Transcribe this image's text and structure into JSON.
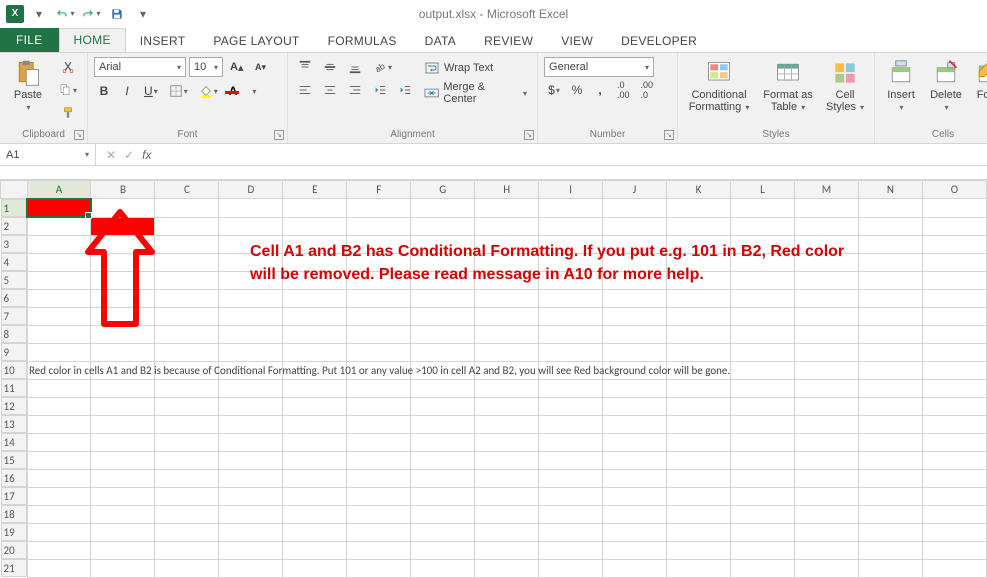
{
  "title": "output.xlsx - Microsoft Excel",
  "qat_xl": "X",
  "tabs": {
    "file": "FILE",
    "home": "HOME",
    "insert": "INSERT",
    "pagelayout": "PAGE LAYOUT",
    "formulas": "FORMULAS",
    "data": "DATA",
    "review": "REVIEW",
    "view": "VIEW",
    "developer": "DEVELOPER"
  },
  "ribbon": {
    "clipboard": {
      "paste": "Paste",
      "label": "Clipboard"
    },
    "font": {
      "name": "Arial",
      "size": "10",
      "label": "Font"
    },
    "alignment": {
      "wrap": "Wrap Text",
      "merge": "Merge & Center",
      "label": "Alignment"
    },
    "number": {
      "fmt": "General",
      "label": "Number"
    },
    "styles": {
      "cond": "Conditional\nFormatting",
      "fmtas": "Format as\nTable",
      "cell": "Cell\nStyles",
      "label": "Styles"
    },
    "cells": {
      "insert": "Insert",
      "delete": "Delete",
      "format": "Forn",
      "label": "Cells"
    }
  },
  "namebox": "A1",
  "columns": [
    "A",
    "B",
    "C",
    "D",
    "E",
    "F",
    "G",
    "H",
    "I",
    "J",
    "K",
    "L",
    "M",
    "N",
    "O"
  ],
  "rows": [
    "1",
    "2",
    "3",
    "4",
    "5",
    "6",
    "7",
    "8",
    "9",
    "10",
    "11",
    "12",
    "13",
    "14",
    "15",
    "16",
    "17",
    "18",
    "19",
    "20",
    "21"
  ],
  "row10_text": "Red color in cells A1 and B2 is because of Conditional Formatting. Put 101 or any value >100 in cell A2 and B2, you will see Red background color will be gone.",
  "callout": {
    "line1": "Cell A1 and B2 has Conditional Formatting. If you put e.g. 101 in B2, Red color",
    "line2": "will be removed. Please read message in A10 for more help."
  }
}
